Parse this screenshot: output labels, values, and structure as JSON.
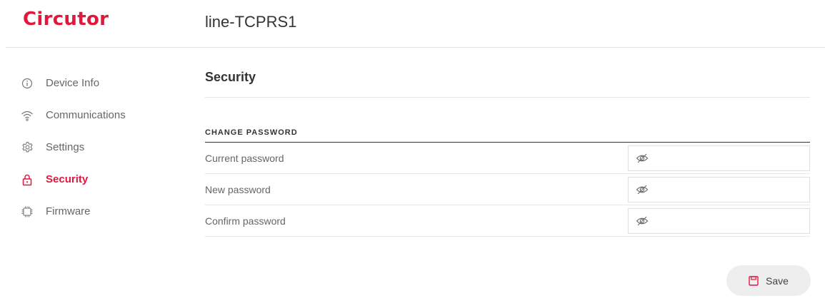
{
  "header": {
    "logo": "Circutor",
    "device_name": "line-TCPRS1"
  },
  "sidebar": {
    "items": [
      {
        "label": "Device Info",
        "icon": "info-icon"
      },
      {
        "label": "Communications",
        "icon": "wifi-icon"
      },
      {
        "label": "Settings",
        "icon": "gear-icon"
      },
      {
        "label": "Security",
        "icon": "lock-icon",
        "active": true
      },
      {
        "label": "Firmware",
        "icon": "chip-icon"
      }
    ]
  },
  "main": {
    "title": "Security",
    "section_title": "CHANGE PASSWORD",
    "fields": [
      {
        "label": "Current password",
        "value": ""
      },
      {
        "label": "New password",
        "value": ""
      },
      {
        "label": "Confirm password",
        "value": ""
      }
    ]
  },
  "actions": {
    "save_label": "Save"
  },
  "colors": {
    "accent": "#e2173e",
    "text": "#666666",
    "button_bg": "#eeeeee"
  }
}
